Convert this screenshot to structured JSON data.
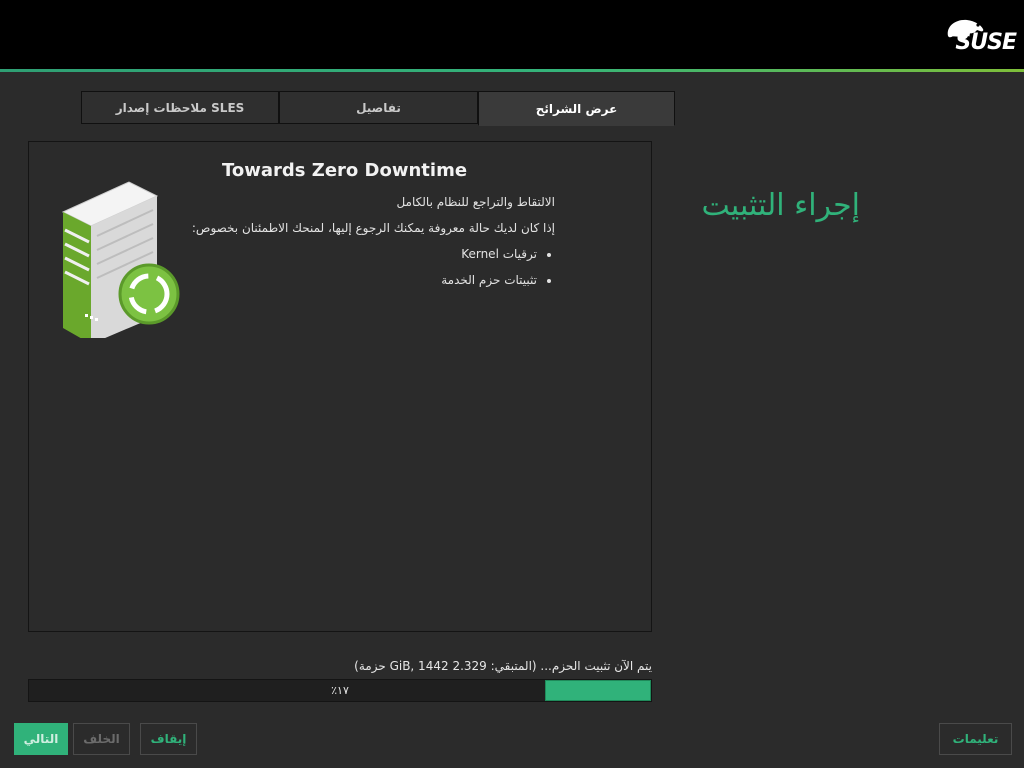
{
  "brand": {
    "logo_text": "SUSE"
  },
  "tabs": [
    {
      "label": "ملاحظات إصدار SLES",
      "active": false
    },
    {
      "label": "تفاصيل",
      "active": false
    },
    {
      "label": "عرض الشرائح",
      "active": true
    }
  ],
  "slide": {
    "title": "Towards Zero Downtime",
    "line1": "الالتقاط والتراجع للنظام بالكامل",
    "line2": "إذا كان لديك حالة معروفة يمكنك الرجوع إليها، لمنحك الاطمئنان بخصوص:",
    "bullets": [
      "ترقيات Kernel",
      "تثبيتات حزم الخدمة"
    ],
    "image_icon": "server-icon"
  },
  "page": {
    "title": "إجراء التثبيت"
  },
  "progress": {
    "status_text": "يتم الآن تثبيت الحزم... (المتبقي: 2.329 GiB, 1442 حزمة)",
    "label": "٪١٧",
    "fraction": 0.17
  },
  "buttons": {
    "next": "التالي",
    "back": "الخلف",
    "abort": "إيقاف",
    "help": "تعليمات"
  },
  "colors": {
    "accent": "#30b27a",
    "background": "#2b2b2b",
    "topbar": "#000000"
  }
}
